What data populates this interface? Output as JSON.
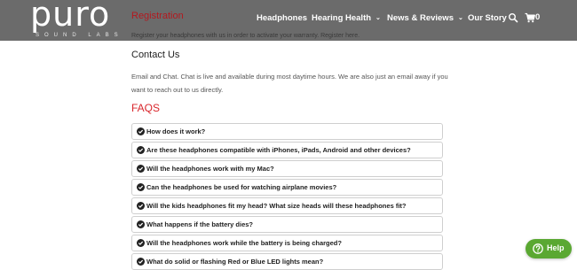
{
  "header": {
    "logo_text": "puro",
    "logo_subtext": "SOUND LABS",
    "registration_title": "Registration",
    "registration_text": "Register your headphones with us in order to activate your warranty. Register here."
  },
  "nav": {
    "items": [
      {
        "label": "Headphones",
        "has_dropdown": false
      },
      {
        "label": "Hearing Health",
        "has_dropdown": true
      },
      {
        "label": "News & Reviews",
        "has_dropdown": true
      },
      {
        "label": "Our Story",
        "has_dropdown": false
      }
    ],
    "search_icon": "search-icon",
    "cart_icon": "cart-icon",
    "cart_count": "0",
    "chevron": "⌄"
  },
  "contact": {
    "title": "Contact Us",
    "text": "Email and Chat. Chat is live and available during most daytime hours. We are also just an email away if you want to reach out to us directly."
  },
  "faqs": {
    "title": "FAQS",
    "items": [
      "How does it work?",
      "Are these headphones compatible with iPhones, iPads, Android and other devices?",
      "Will the headphones work with my Mac?",
      "Can the headphones be used for watching airplane movies?",
      "Will the kids headphones fit my head? What size heads will these headphones fit?",
      "What happens if the battery dies?",
      "Will the headphones work while the battery is being charged?",
      "What do solid or flashing Red or Blue LED lights mean?"
    ]
  },
  "help": {
    "label": "Help",
    "icon": "question-icon",
    "color": "#5aa832"
  },
  "colors": {
    "header_bg": "#6b6b6b",
    "accent_red": "#d9262c",
    "registration_red": "#b3191f"
  }
}
